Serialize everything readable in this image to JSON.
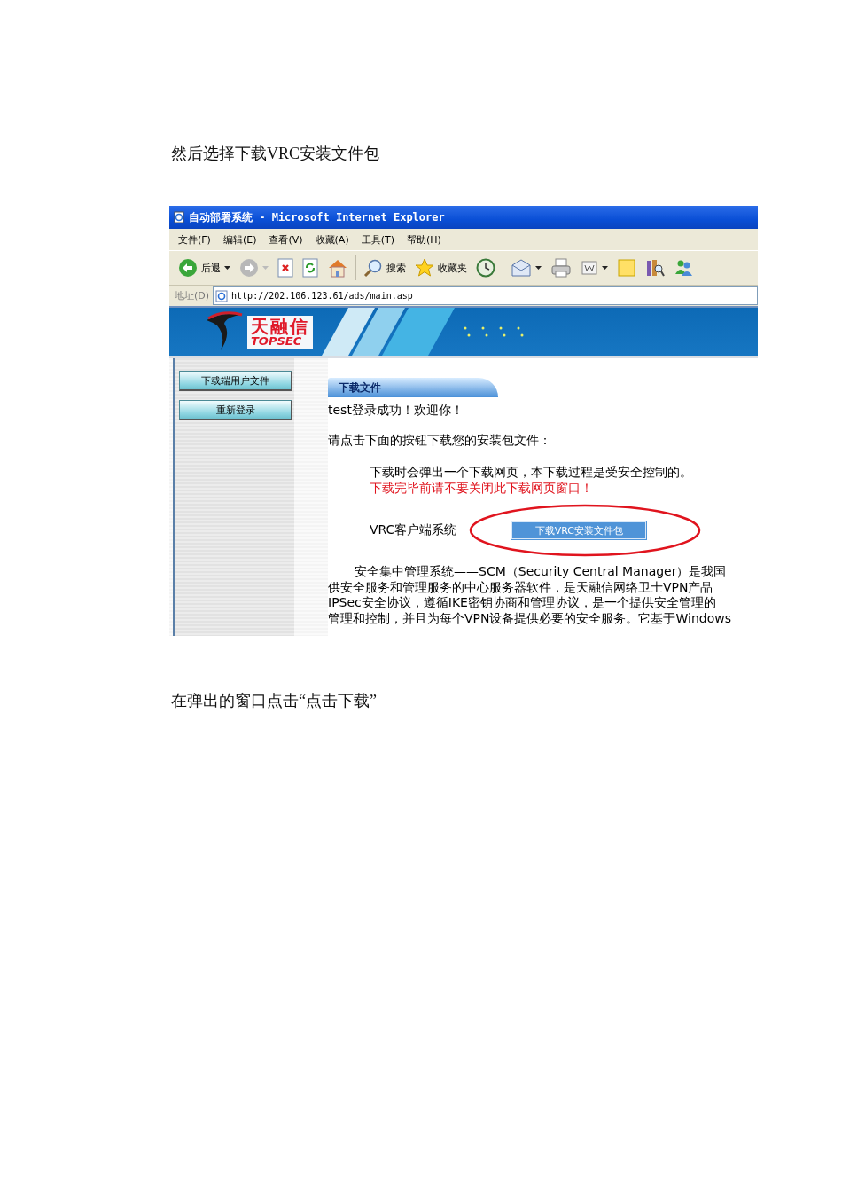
{
  "document": {
    "intro": "然后选择下载VRC安装文件包",
    "caption": "在弹出的窗口点击“点击下载”"
  },
  "browser": {
    "title": "自动部署系统 - Microsoft Internet Explorer",
    "menu": [
      "文件(F)",
      "编辑(E)",
      "查看(V)",
      "收藏(A)",
      "工具(T)",
      "帮助(H)"
    ],
    "toolbar": [
      {
        "kind": "back",
        "label": "后退",
        "dropdown": true
      },
      {
        "kind": "forward",
        "dropdown": true
      },
      {
        "kind": "stop",
        "dropdown": false
      },
      {
        "kind": "refresh",
        "dropdown": false
      },
      {
        "kind": "home",
        "dropdown": false
      },
      {
        "kind": "separator"
      },
      {
        "kind": "search",
        "label": "搜索",
        "dropdown": false
      },
      {
        "kind": "favorites",
        "label": "收藏夹",
        "dropdown": false
      },
      {
        "kind": "history",
        "dropdown": false
      },
      {
        "kind": "separator"
      },
      {
        "kind": "mail",
        "dropdown": true
      },
      {
        "kind": "print",
        "dropdown": false
      },
      {
        "kind": "edit",
        "dropdown": true
      },
      {
        "kind": "note",
        "dropdown": false
      },
      {
        "kind": "research",
        "dropdown": false
      },
      {
        "kind": "messenger",
        "dropdown": false
      }
    ],
    "address_label": "地址(D)",
    "address": "http://202.106.123.61/ads/main.asp"
  },
  "page": {
    "logo": {
      "name": "天融信",
      "sub": "TOPSEC"
    },
    "sidebar": [
      {
        "label": "下载端用户文件"
      },
      {
        "label": "重新登录"
      }
    ],
    "tab": "下载文件",
    "welcome": "test登录成功！欢迎你！",
    "prompt": "请点击下面的按钮下载您的安装包文件：",
    "note": "下载时会弹出一个下载网页，本下载过程是受安全控制的。",
    "warning": "下载完毕前请不要关闭此下载网页窗口！",
    "client_label": "VRC客户端系统",
    "download_button": "下载VRC安装文件包",
    "description": [
      "安全集中管理系统——SCM（Security Central Manager）是我国",
      "供安全服务和管理服务的中心服务器软件，是天融信网络卫士VPN产品",
      "IPSec安全协议，遵循IKE密钥协商和管理协议，是一个提供安全管理的",
      "管理和控制，并且为每个VPN设备提供必要的安全服务。它基于Windows"
    ]
  }
}
